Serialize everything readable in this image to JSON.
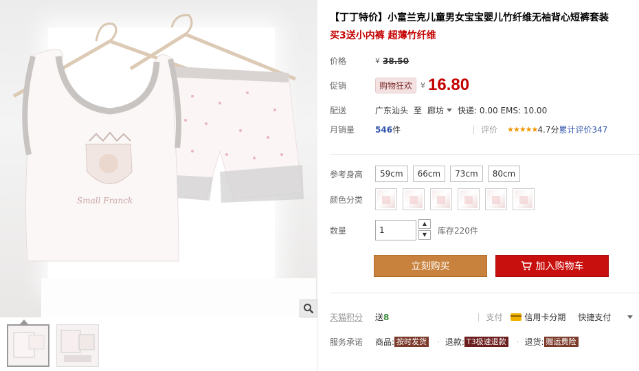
{
  "product": {
    "title": "【丁丁特价】小富兰克儿童男女宝宝婴儿竹纤维无袖背心短裤套装",
    "subtitle": "买3送小内裤 超薄竹纤维"
  },
  "price": {
    "label": "价格",
    "currency": "¥",
    "original": "38.50"
  },
  "promo": {
    "label": "促销",
    "tag": "购物狂欢",
    "currency": "¥",
    "price": "16.80"
  },
  "shipping": {
    "label": "配送",
    "from": "广东汕头",
    "to_word": "至",
    "destination": "廊坊",
    "fees": "快递: 0.00 EMS: 10.00"
  },
  "sales": {
    "label": "月销量",
    "count": "546",
    "unit": "件",
    "rating_label": "评价",
    "stars": "★★★★★",
    "score_text": "4.7分",
    "review_text": "累计评价347"
  },
  "options": {
    "size_label": "参考身高",
    "sizes": [
      "59cm",
      "66cm",
      "73cm",
      "80cm"
    ],
    "color_label": "颜色分类",
    "color_count": 6,
    "qty_label": "数量",
    "qty_value": "1",
    "stock": "库存220件"
  },
  "actions": {
    "buy_now": "立刻购买",
    "add_cart": "加入购物车"
  },
  "tmall": {
    "points_label": "天猫积分",
    "points_prefix": "送",
    "points_value": "8",
    "pay_label": "支付",
    "credit": "信用卡分期",
    "quick_pay": "快捷支付"
  },
  "service": {
    "label": "服务承诺",
    "goods_prefix": "商品:",
    "goods_tag": "按时发货",
    "refund_prefix": "退款:",
    "refund_tag": "T3极速退款",
    "return_prefix": "退货:",
    "return_tag": "赠运费险"
  },
  "photo": {
    "shirt_text": "Small Franck"
  },
  "colors": {
    "price_red": "#c40000",
    "buy_btn": "#c8823e",
    "cart_btn": "#c8100e"
  }
}
